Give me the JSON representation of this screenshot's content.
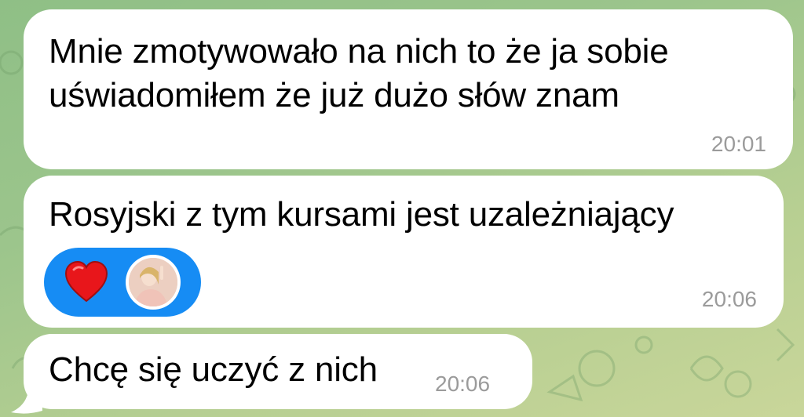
{
  "chat": {
    "messages": [
      {
        "text_lines": [
          "Mnie zmotywowało na nich to że ja sobie",
          "uświadomiłem że już dużo słów znam"
        ],
        "time": "20:01"
      },
      {
        "text": "Rosyjski z tym kursami jest uzależniający",
        "time": "20:06",
        "reaction": {
          "emoji_icon": "heart-icon",
          "reactor_icon": "avatar"
        }
      },
      {
        "text": "Chcę się uczyć z nich",
        "time": "20:06"
      }
    ]
  },
  "colors": {
    "bubble": "#ffffff",
    "reaction_pill": "#168cf4",
    "heart": "#e8161b",
    "timestamp": "#9b9b9b"
  }
}
